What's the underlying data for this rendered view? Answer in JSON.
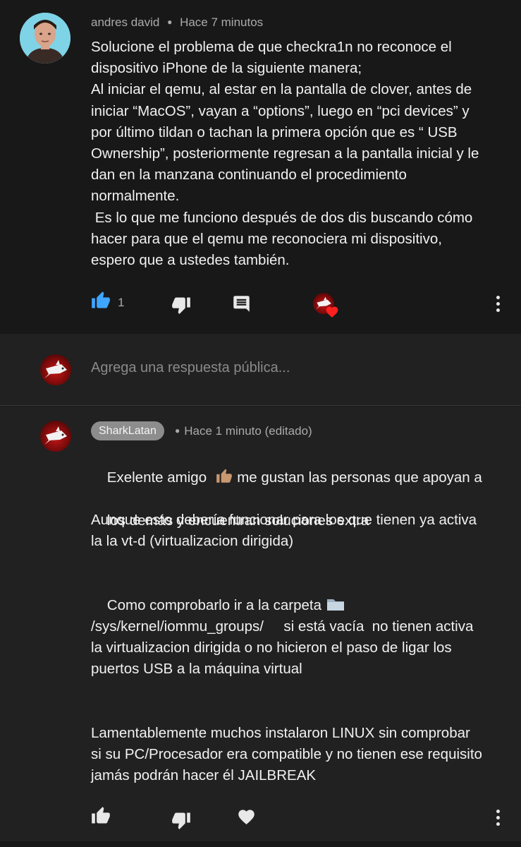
{
  "top_comment": {
    "author": "andres david",
    "time": "Hace 7 minutos",
    "body": "Solucione el problema de que checkra1n no reconoce el\ndispositivo iPhone de la siguiente manera;\nAl iniciar el qemu, al estar en la pantalla de clover, antes de\niniciar “MacOS”, vayan a “options”, luego en “pci devices” y\npor último tildan o tachan la primera opción que es “ USB\nOwnership”, posteriormente regresan a la pantalla inicial y le\ndan en la manzana continuando el procedimiento\nnormalmente.\n Es lo que me funciono después de dos dis buscando cómo\nhacer para que el qemu me reconociera mi dispositivo,\nespero que a ustedes también.",
    "like_count": "1",
    "icons": {
      "like": "thumb-up-icon",
      "dislike": "thumb-down-icon",
      "reply": "comment-icon",
      "creator_heart": "creator-heart-icon",
      "more": "more-vert-icon"
    },
    "colors": {
      "like_active": "#3ea6ff",
      "heart": "#ff0000"
    }
  },
  "reply_box": {
    "placeholder": "Agrega una respuesta pública..."
  },
  "reply_comment": {
    "author": "SharkLatan",
    "time": "Hace 1 minuto (editado)",
    "line1_before_emoji": "Exelente amigo  ",
    "line1_after_emoji": " me gustan las personas que apoyan a",
    "line2": "los demás y encuentran soluciones extra",
    "para2": "Aunque esto debería funcionar para los que tienen ya activa\nla la vt-d (virtualizacion dirigida)",
    "para3": "Como comprobarlo ir a la carpeta ",
    "para4": "/sys/kernel/iommu_groups/     si está vacía  no tienen activa\nla virtualizacion dirigida o no hicieron el paso de ligar los\npuertos USB a la máquina virtual",
    "para5": "Lamentablemente muchos instalaron LINUX sin comprobar\nsi su PC/Procesador era compatible y no tienen ese requisito\njamás podrán hacer él JAILBREAK",
    "icons": {
      "thumbs_up_emoji": "thumbs-up-emoji",
      "folder_emoji": "folder-emoji",
      "like": "thumb-up-icon",
      "dislike": "thumb-down-icon",
      "heart": "heart-icon",
      "more": "more-vert-icon"
    }
  }
}
